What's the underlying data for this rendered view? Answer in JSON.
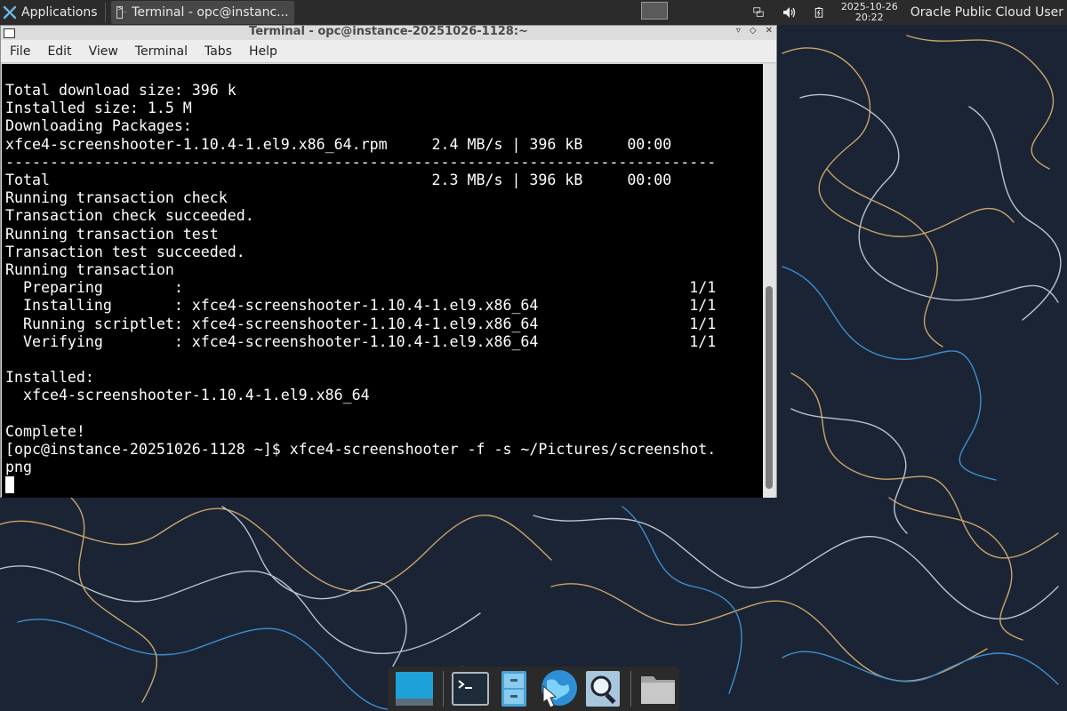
{
  "top_panel": {
    "applications_label": "Applications",
    "task_title": "Terminal - opc@instanc...",
    "clock_date": "2025-10-26",
    "clock_time": "20:22",
    "user_label": "Oracle Public Cloud User",
    "icons": [
      "applications-logo-icon",
      "terminal-icon",
      "network-icon",
      "volume-icon",
      "battery-icon"
    ]
  },
  "terminal_window": {
    "title": "Terminal - opc@instance-20251026-1128:~",
    "window_controls": [
      "minimize",
      "maximize",
      "close"
    ],
    "menu": [
      "File",
      "Edit",
      "View",
      "Terminal",
      "Tabs",
      "Help"
    ],
    "lines": [
      "Total download size: 396 k",
      "Installed size: 1.5 M",
      "Downloading Packages:",
      "xfce4-screenshooter-1.10.4-1.el9.x86_64.rpm     2.4 MB/s | 396 kB     00:00",
      "--------------------------------------------------------------------------------",
      "Total                                           2.3 MB/s | 396 kB     00:00",
      "Running transaction check",
      "Transaction check succeeded.",
      "Running transaction test",
      "Transaction test succeeded.",
      "Running transaction",
      "  Preparing        :                                                         1/1",
      "  Installing       : xfce4-screenshooter-1.10.4-1.el9.x86_64                 1/1",
      "  Running scriptlet: xfce4-screenshooter-1.10.4-1.el9.x86_64                 1/1",
      "  Verifying        : xfce4-screenshooter-1.10.4-1.el9.x86_64                 1/1",
      "",
      "Installed:",
      "  xfce4-screenshooter-1.10.4-1.el9.x86_64",
      "",
      "Complete!",
      "[opc@instance-20251026-1128 ~]$ xfce4-screenshooter -f -s ~/Pictures/screenshot.",
      "png"
    ]
  },
  "dock": {
    "items": [
      "show-desktop-icon",
      "terminal-icon",
      "file-cabinet-icon",
      "web-browser-icon",
      "search-icon",
      "folder-icon"
    ]
  },
  "colors": {
    "panel_bg": "#2b2b2b",
    "terminal_bg": "#000000",
    "terminal_fg": "#ffffff",
    "wallpaper_bg": "#1b2434",
    "wallpaper_line_gold": "#c9a46a",
    "wallpaper_line_blue": "#3b8fd0",
    "wallpaper_line_pale": "#b9c3cf"
  }
}
